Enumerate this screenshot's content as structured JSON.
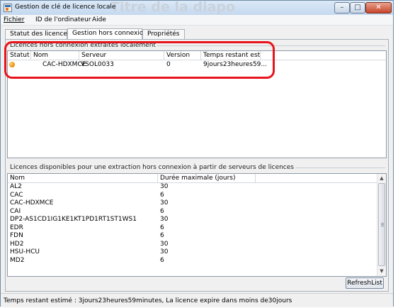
{
  "window": {
    "title": "Gestion de clé de licence locale",
    "ghost_title": "Titre de la diapo",
    "min_glyph": "–",
    "max_glyph": "□",
    "close_glyph": "✕"
  },
  "menu": [
    "Fichier",
    "ID de l'ordinateur",
    "Aide"
  ],
  "tabs": [
    "Statut des licences",
    "Gestion hors connexion",
    "Propriétés"
  ],
  "active_tab": 1,
  "local_group": {
    "label": "Licences hors connexion extraites localement",
    "columns": [
      "Statut",
      "Nom",
      "Serveur",
      "Version",
      "Temps restant esti..."
    ],
    "rows": [
      {
        "status": "orange",
        "name": "CAC-HDXMCE",
        "server": "VSOL0033",
        "version": "0",
        "remaining": "9jours23heures59..."
      }
    ]
  },
  "server_group": {
    "label": "Licences disponibles pour une extraction hors connexion à partir de serveurs de licences",
    "columns": [
      "Nom",
      "Durée maximale (jours)"
    ],
    "rows": [
      {
        "name": "AL2",
        "days": "30"
      },
      {
        "name": "CAC",
        "days": "6"
      },
      {
        "name": "CAC-HDXMCE",
        "days": "30"
      },
      {
        "name": "CAI",
        "days": "6"
      },
      {
        "name": "DP2-AS1CD1IG1KE1KT1PD1RT1ST1WS1",
        "days": "30"
      },
      {
        "name": "EDR",
        "days": "6"
      },
      {
        "name": "FDN",
        "days": "6"
      },
      {
        "name": "HD2",
        "days": "30"
      },
      {
        "name": "HSU-HCU",
        "days": "30"
      },
      {
        "name": "MD2",
        "days": "6"
      }
    ],
    "scroll_up": "▲",
    "scroll_down": "▼"
  },
  "refresh_label": "RefreshList",
  "status_bar": "Temps restant estimé : 3jours23heures59minutes, La licence expire dans moins de30jours",
  "colors": {
    "annotation": "#e8141b",
    "status_orange": "#e88a00"
  }
}
